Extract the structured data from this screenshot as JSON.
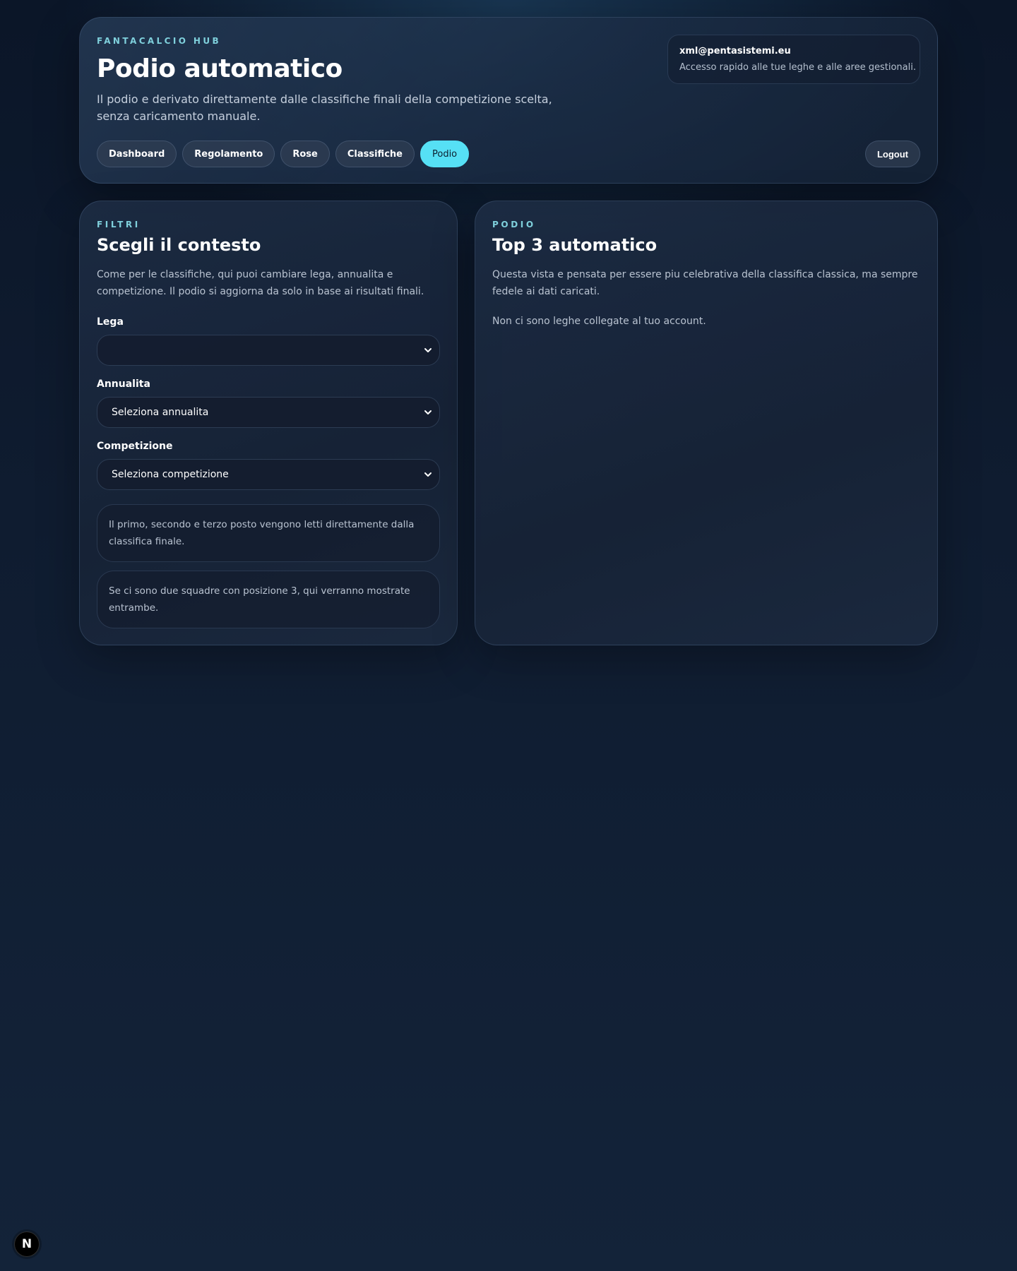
{
  "header": {
    "eyebrow": "FANTACALCIO HUB",
    "title": "Podio automatico",
    "subtitle": "Il podio e derivato direttamente dalle classifiche finali della competizione scelta, senza caricamento manuale.",
    "account": {
      "email": "xml@pentasistemi.eu",
      "description": "Accesso rapido alle tue leghe e alle aree gestionali."
    },
    "nav": [
      {
        "label": "Dashboard",
        "active": false
      },
      {
        "label": "Regolamento",
        "active": false
      },
      {
        "label": "Rose",
        "active": false
      },
      {
        "label": "Classifiche",
        "active": false
      },
      {
        "label": "Podio",
        "active": true
      }
    ],
    "logout_label": "Logout"
  },
  "filters": {
    "eyebrow": "FILTRI",
    "title": "Scegli il contesto",
    "intro": "Come per le classifiche, qui puoi cambiare lega, annualita e competizione. Il podio si aggiorna da solo in base ai risultati finali.",
    "lega": {
      "label": "Lega",
      "value": ""
    },
    "annualita": {
      "label": "Annualita",
      "value": "Seleziona annualita"
    },
    "competizione": {
      "label": "Competizione",
      "value": "Seleziona competizione"
    },
    "notes": [
      "Il primo, secondo e terzo posto vengono letti direttamente dalla classifica finale.",
      "Se ci sono due squadre con posizione 3, qui verranno mostrate entrambe."
    ]
  },
  "podio": {
    "eyebrow": "PODIO",
    "title": "Top 3 automatico",
    "intro": "Questa vista e pensata per essere piu celebrativa della classifica classica, ma sempre fedele ai dati caricati.",
    "empty_message": "Non ci sono leghe collegate al tuo account."
  },
  "dev_badge": {
    "label": "N"
  },
  "colors": {
    "accent": "#56e0f5",
    "eyebrow": "#7fd0dc"
  }
}
